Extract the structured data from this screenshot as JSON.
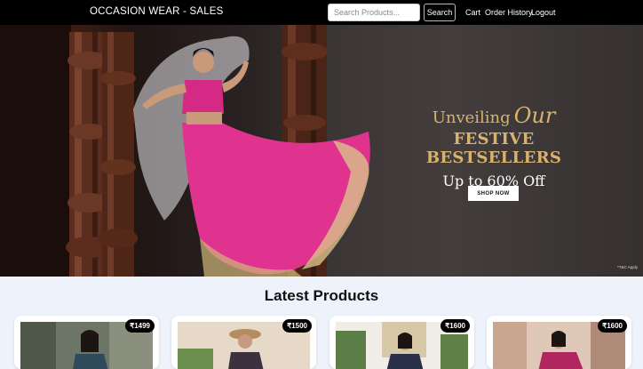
{
  "navbar": {
    "brand": "OCCASION WEAR - SALES",
    "search_placeholder": "Search Products...",
    "search_button": "Search",
    "links": [
      "Cart",
      "Order History",
      "Logout"
    ]
  },
  "hero": {
    "line1": "Unveiling",
    "line1_script": "Our",
    "line2": "FESTIVE BESTSELLERS",
    "line3": "Up to 60% Off",
    "cta": "SHOP NOW",
    "fineprint": "*T&C Apply"
  },
  "section": {
    "title": "Latest Products"
  },
  "products": [
    {
      "price": "₹1499"
    },
    {
      "price": "₹1500"
    },
    {
      "price": "₹1600"
    },
    {
      "price": "₹1600"
    }
  ],
  "colors": {
    "navbar_bg": "#000000",
    "page_bg": "#eef2fb",
    "hero_gold": "#d8b36f",
    "accent_pink": "#e0338f"
  }
}
